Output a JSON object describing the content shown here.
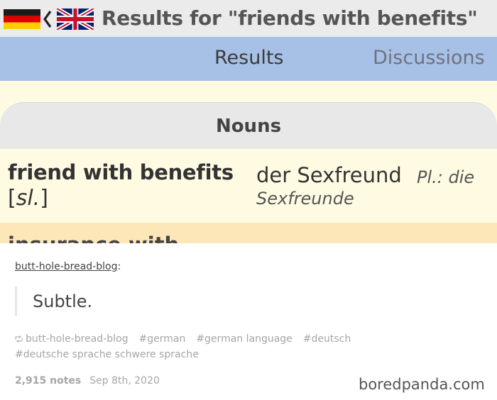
{
  "app": {
    "header": {
      "title": "Results for \"friends with benefits\"",
      "source_flag": "germany-flag",
      "target_flag": "uk-flag"
    },
    "tabs": [
      {
        "label": "Results",
        "active": true
      },
      {
        "label": "Discussions",
        "active": false
      }
    ],
    "section": {
      "title": "Nouns"
    },
    "entry": {
      "english": "friend with benefits",
      "register_tag": "sl.",
      "german": "der Sexfreund",
      "plural_label": "Pl.: die",
      "plural_form": "Sexfreunde"
    },
    "next_entry": {
      "english_partial": "insurance with"
    },
    "colors": {
      "tab_bar": "#a7c0e6",
      "row_bg": "#fffbe3",
      "row_alt_bg": "#fde6b8"
    }
  },
  "post": {
    "author": "butt-hole-bread-blog",
    "author_suffix": ":",
    "quote": "Subtle.",
    "reblog_source": "butt-hole-bread-blog",
    "tags": [
      "#german",
      "#german language",
      "#deutsch",
      "#deutsche sprache schwere sprache"
    ],
    "notes": "2,915 notes",
    "date": "Sep 8th, 2020"
  },
  "watermark": "boredpanda.com"
}
